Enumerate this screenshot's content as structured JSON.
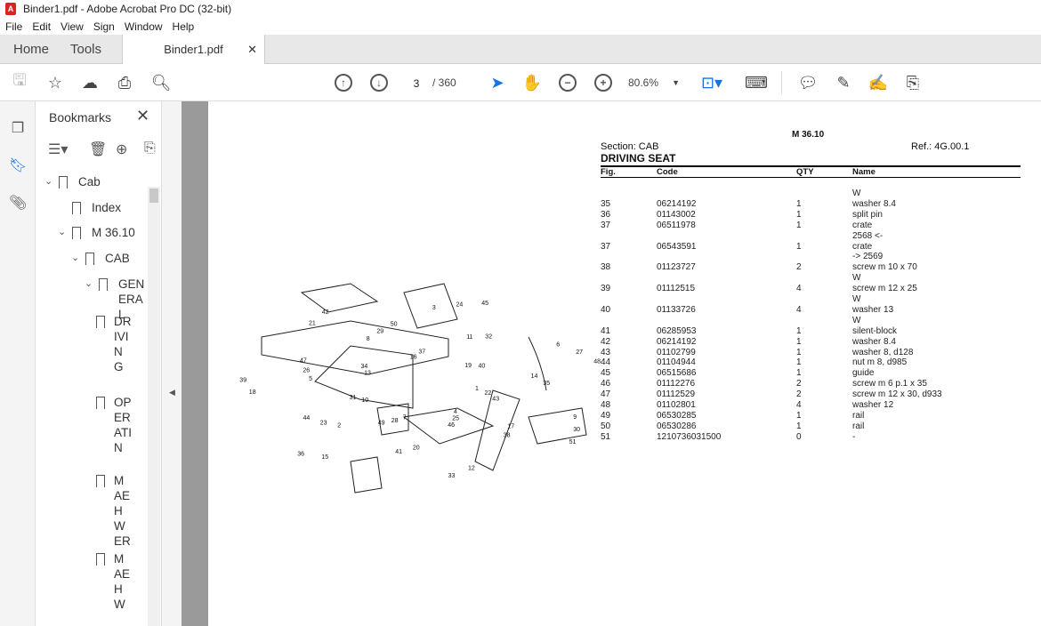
{
  "window": {
    "title": "Binder1.pdf - Adobe Acrobat Pro DC (32-bit)"
  },
  "menu": [
    "File",
    "Edit",
    "View",
    "Sign",
    "Window",
    "Help"
  ],
  "tabs": {
    "home": "Home",
    "tools": "Tools",
    "document": "Binder1.pdf"
  },
  "toolbar": {
    "current_page": "3",
    "total_pages": "/ 360",
    "zoom": "80.6%"
  },
  "bookmarks": {
    "title": "Bookmarks",
    "items": [
      {
        "label": "Cab",
        "level": 0,
        "expanded": true
      },
      {
        "label": "Index",
        "level": 1
      },
      {
        "label": "M 36.10",
        "level": 1,
        "expanded": true
      },
      {
        "label": "CAB",
        "level": 2,
        "expanded": true
      },
      {
        "label": "GENERAL",
        "level": 3,
        "expanded": true
      },
      {
        "label": "DRIVING",
        "level": 4
      },
      {
        "label": "OPERATIN",
        "level": 4
      },
      {
        "label": "MAEHWER",
        "level": 4
      },
      {
        "label": "MAEHW",
        "level": 4
      }
    ]
  },
  "doc": {
    "model": "M 36.10",
    "section": "Section: CAB",
    "ref": "Ref.: 4G.00.1",
    "title": "DRIVING SEAT",
    "columns": [
      "Fig.",
      "Code",
      "QTY",
      "Name"
    ],
    "rows": [
      {
        "fig": "",
        "code": "",
        "qty": "",
        "name": "W"
      },
      {
        "fig": "35",
        "code": "06214192",
        "qty": "1",
        "name": "washer 8.4"
      },
      {
        "fig": "36",
        "code": "01143002",
        "qty": "1",
        "name": "split pin"
      },
      {
        "fig": "37",
        "code": "06511978",
        "qty": "1",
        "name": "crate"
      },
      {
        "fig": "",
        "code": "",
        "qty": "",
        "name": "2568 <-"
      },
      {
        "fig": "37",
        "code": "06543591",
        "qty": "1",
        "name": "crate"
      },
      {
        "fig": "",
        "code": "",
        "qty": "",
        "name": "-> 2569"
      },
      {
        "fig": "38",
        "code": "01123727",
        "qty": "2",
        "name": "screw m 10 x 70"
      },
      {
        "fig": "",
        "code": "",
        "qty": "",
        "name": "W"
      },
      {
        "fig": "39",
        "code": "01112515",
        "qty": "4",
        "name": "screw m 12 x 25"
      },
      {
        "fig": "",
        "code": "",
        "qty": "",
        "name": "W"
      },
      {
        "fig": "40",
        "code": "01133726",
        "qty": "4",
        "name": "washer 13"
      },
      {
        "fig": "",
        "code": "",
        "qty": "",
        "name": "W"
      },
      {
        "fig": "41",
        "code": "06285953",
        "qty": "1",
        "name": "silent-block"
      },
      {
        "fig": "42",
        "code": "06214192",
        "qty": "1",
        "name": "washer 8.4"
      },
      {
        "fig": "43",
        "code": "01102799",
        "qty": "1",
        "name": "washer 8, d128"
      },
      {
        "fig": "44",
        "code": "01104944",
        "qty": "1",
        "name": "nut m 8, d985"
      },
      {
        "fig": "45",
        "code": "06515686",
        "qty": "1",
        "name": "guide"
      },
      {
        "fig": "46",
        "code": "01112276",
        "qty": "2",
        "name": "screw m 6 p.1 x 35"
      },
      {
        "fig": "47",
        "code": "01112529",
        "qty": "2",
        "name": "screw m 12 x 30, d933"
      },
      {
        "fig": "48",
        "code": "01102801",
        "qty": "4",
        "name": "washer 12"
      },
      {
        "fig": "49",
        "code": "06530285",
        "qty": "1",
        "name": "rail"
      },
      {
        "fig": "50",
        "code": "06530286",
        "qty": "1",
        "name": "rail"
      },
      {
        "fig": "51",
        "code": "1210736031500",
        "qty": "0",
        "name": "-"
      }
    ],
    "diagram_labels": [
      "1",
      "2",
      "3",
      "4",
      "5",
      "6",
      "7",
      "8",
      "9",
      "10",
      "11",
      "12",
      "13",
      "14",
      "15",
      "16",
      "17",
      "18",
      "19",
      "20",
      "21",
      "22",
      "23",
      "24",
      "25",
      "26",
      "27",
      "28",
      "29",
      "30",
      "31",
      "32",
      "33",
      "34",
      "35",
      "36",
      "37",
      "38",
      "39",
      "40",
      "41",
      "42",
      "43",
      "44",
      "45",
      "46",
      "47",
      "48",
      "49",
      "50",
      "51"
    ]
  }
}
